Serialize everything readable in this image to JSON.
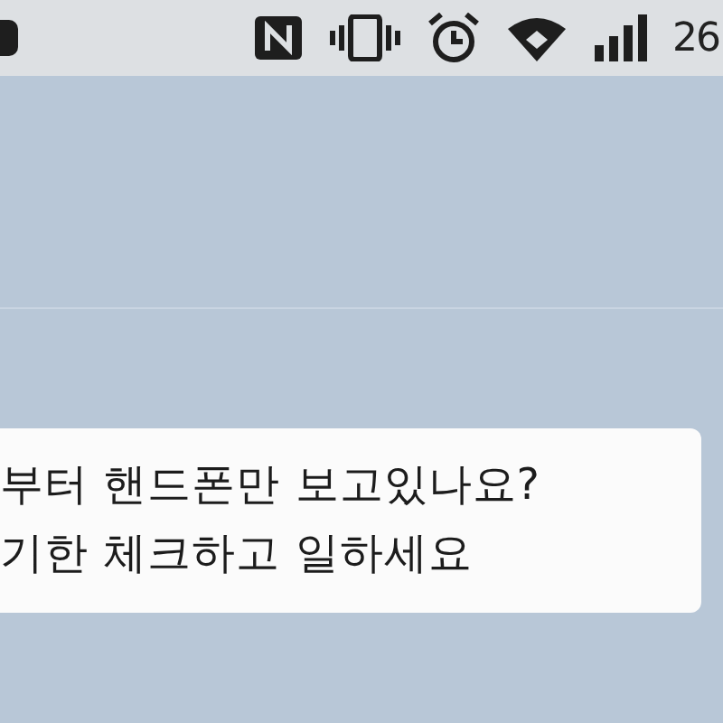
{
  "status_bar": {
    "time": "26"
  },
  "message": {
    "lines": [
      "부터 핸드폰만 보고있나요?",
      "기한 체크하고 일하세요"
    ]
  }
}
